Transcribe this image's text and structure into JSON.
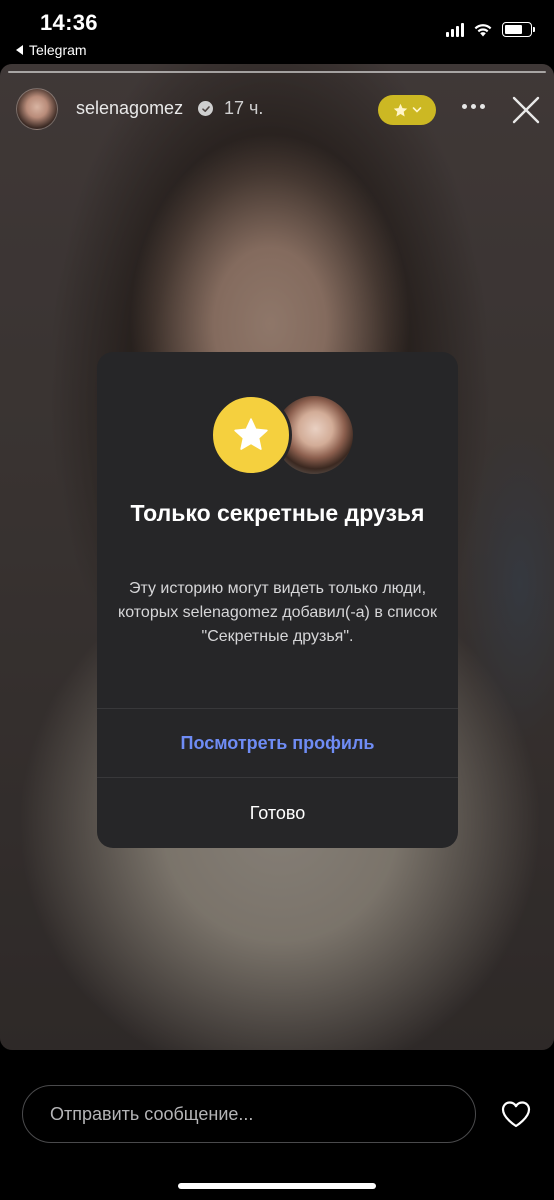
{
  "status_bar": {
    "time": "14:36",
    "back_app": "Telegram"
  },
  "story": {
    "username": "selenagomez",
    "time_ago": "17 ч.",
    "audience_badge_icon": "star-icon",
    "more_icon": "more-dots-icon",
    "close_icon": "close-icon"
  },
  "modal": {
    "title": "Только секретные друзья",
    "description": "Эту историю могут видеть только люди, которых selenagomez добавил(-а) в список \"Секретные друзья\".",
    "view_profile": "Посмотреть профиль",
    "done": "Готово"
  },
  "bottom_bar": {
    "message_placeholder": "Отправить сообщение...",
    "like_icon": "heart-icon"
  },
  "colors": {
    "star_yellow": "#f5d03e",
    "badge_yellow": "#ccb823",
    "link_blue": "#6f8cf5",
    "modal_bg": "#262628"
  }
}
